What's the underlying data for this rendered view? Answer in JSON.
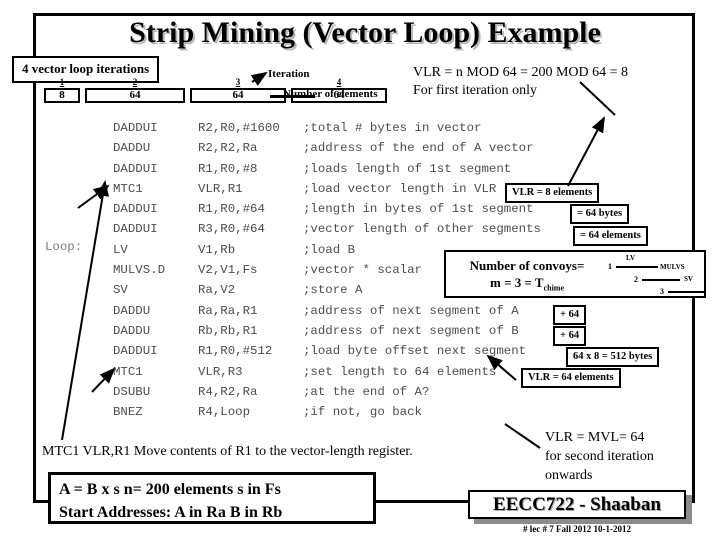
{
  "slide": {
    "title": "Strip Mining (Vector Loop) Example",
    "callout_iterations": "4 vector loop iterations",
    "iteration_label": "Iteration",
    "elements_label": "Number of elements",
    "strip": [
      {
        "index": "1",
        "value": "8"
      },
      {
        "index": "2",
        "value": "64"
      },
      {
        "index": "3",
        "value": "64"
      },
      {
        "index": "4",
        "value": "64"
      }
    ],
    "vlr_header_line1": "VLR = n MOD 64 = 200 MOD 64 = 8",
    "vlr_header_line2": "For first iteration only",
    "loop_label": "Loop:",
    "code": [
      {
        "op": "DADDUI",
        "args": "R2,R0,#1600",
        "comment": ";total # bytes in vector"
      },
      {
        "op": "DADDU",
        "args": "R2,R2,Ra",
        "comment": ";address of the end of A vector"
      },
      {
        "op": "DADDUI",
        "args": "R1,R0,#8",
        "comment": ";loads length of 1st segment"
      },
      {
        "op": "MTC1",
        "args": "VLR,R1",
        "comment": ";load vector length in VLR"
      },
      {
        "op": "DADDUI",
        "args": "R1,R0,#64",
        "comment": ";length in bytes of 1st segment"
      },
      {
        "op": "DADDUI",
        "args": "R3,R0,#64",
        "comment": ";vector length of other segments"
      },
      {
        "op": "LV",
        "args": "V1,Rb",
        "comment": ";load B"
      },
      {
        "op": "MULVS.D",
        "args": "V2,V1,Fs",
        "comment": ";vector * scalar"
      },
      {
        "op": "SV",
        "args": "Ra,V2",
        "comment": ";store A"
      },
      {
        "op": "DADDU",
        "args": "Ra,Ra,R1",
        "comment": ";address of next segment of A"
      },
      {
        "op": "DADDU",
        "args": "Rb,Rb,R1",
        "comment": ";address of next segment of B"
      },
      {
        "op": "DADDUI",
        "args": "R1,R0,#512",
        "comment": ";load byte offset next segment"
      },
      {
        "op": "MTC1",
        "args": "VLR,R3",
        "comment": ";set length to 64 elements"
      },
      {
        "op": "DSUBU",
        "args": "R4,R2,Ra",
        "comment": ";at the end of A?"
      },
      {
        "op": "BNEZ",
        "args": "R4,Loop",
        "comment": ";if not, go back"
      }
    ],
    "annotations": {
      "vlr_8": "VLR = 8 elements",
      "bytes_64": "= 64 bytes",
      "elements_64": "= 64 elements",
      "plus64_a": "+ 64",
      "plus64_b": "+ 64",
      "bytes_512": "64 x 8 = 512 bytes",
      "vlr_64": "VLR = 64 elements"
    },
    "convoys": {
      "line1": "Number of convoys=",
      "line2_prefix": "m = 3 = T",
      "line2_sub": "chime",
      "stairs": [
        {
          "num": "1",
          "label": "LV"
        },
        {
          "num": "2",
          "label": "MULVS"
        },
        {
          "num": "3",
          "label": "SV"
        }
      ]
    },
    "mtc1_note": "MTC1 VLR,R1   Move contents of R1 to the vector-length register.",
    "bottom_box_line1": "A = B x s    n= 200 elements    s in Fs",
    "bottom_box_line2": "Start Addresses:  A in Ra   B in Rb",
    "vlr_mvl": [
      "VLR = MVL= 64",
      "for second iteration",
      "onwards"
    ],
    "footer_title": "EECC722 - Shaaban",
    "footer_sub": "#  lec # 7    Fall 2012   10-1-2012"
  }
}
